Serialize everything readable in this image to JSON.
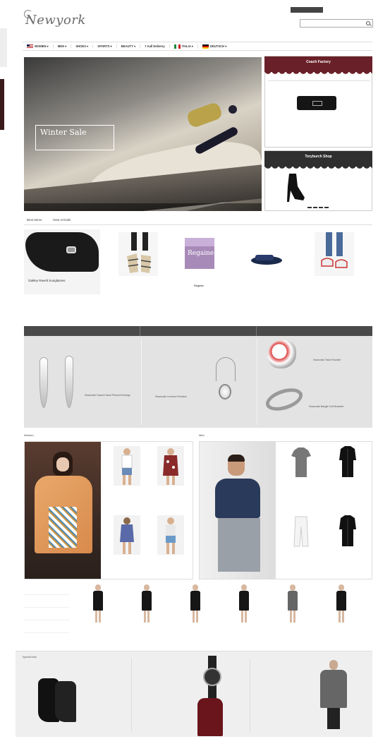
{
  "header": {
    "logo": "Newyork",
    "top_banner": "",
    "util_links": [
      "",
      "",
      "",
      ""
    ],
    "quick_links": [
      "",
      "",
      "",
      "",
      ""
    ],
    "search_placeholder": ""
  },
  "nav": {
    "items": [
      "WOMEN ▾",
      "MEN ▾",
      "SHOES ▾",
      "SPORTS ▾",
      "BEAUTY ▾",
      "7 Aall Delivery",
      "ITALIA ▾",
      "DEUTSCH ▾"
    ]
  },
  "hero": {
    "caption_title": "Winter Sale",
    "caption_sub": "",
    "slide_labels": [
      "",
      "",
      "",
      "",
      ""
    ]
  },
  "coach": {
    "banner": "Coach Factory",
    "tabs": [
      "",
      "",
      "",
      ""
    ],
    "product_name": "",
    "product_desc": "",
    "price": ""
  },
  "tory": {
    "banner": "Toryburch Shop",
    "product_name": "",
    "product_desc": "",
    "price": ""
  },
  "best": {
    "tabs": [
      "Best Items",
      "New Arrivals"
    ],
    "feature_caption": "Oakley Ravelt Sunglasses",
    "items": [
      {
        "name": "",
        "desc": "",
        "price": ""
      },
      {
        "name": "Regaine",
        "desc": "",
        "price": ""
      },
      {
        "name": "",
        "desc": "",
        "price": ""
      },
      {
        "name": "",
        "desc": "",
        "price": ""
      }
    ]
  },
  "jewelry": {
    "heads": [
      "",
      "",
      ""
    ],
    "items": [
      {
        "name": "Swarovski Casuini Sand Pierced Earrings"
      },
      {
        "name": "Swarovski Lemmon Pendant"
      },
      {
        "name": "Swarovski Tisdol Rooster"
      },
      {
        "name": "Swarovski Bangle Cuff Bracelet"
      }
    ]
  },
  "women": {
    "label": "Women",
    "items": [
      {
        "name": "",
        "desc": "",
        "price": ""
      },
      {
        "name": "",
        "desc": "",
        "price": ""
      },
      {
        "name": "",
        "desc": "",
        "price": ""
      },
      {
        "name": "",
        "desc": "",
        "price": ""
      }
    ]
  },
  "men": {
    "label": "Men",
    "items": [
      {
        "name": "",
        "desc": "",
        "price": ""
      },
      {
        "name": "",
        "desc": "",
        "price": ""
      },
      {
        "name": "",
        "desc": "",
        "price": ""
      },
      {
        "name": "",
        "desc": "",
        "price": ""
      }
    ]
  },
  "categories": [
    "",
    "",
    "",
    "",
    ""
  ],
  "dresses": [
    {
      "name": "",
      "desc": "",
      "price": ""
    },
    {
      "name": "",
      "desc": "",
      "price": ""
    },
    {
      "name": "",
      "desc": "",
      "price": ""
    },
    {
      "name": "",
      "desc": "",
      "price": ""
    },
    {
      "name": "",
      "desc": "",
      "price": ""
    },
    {
      "name": "",
      "desc": "",
      "price": ""
    }
  ],
  "special": {
    "label": "Special Deal",
    "boot_name": "",
    "boot_desc": "",
    "watch_name": "",
    "watch_desc": "",
    "burberry_name": "",
    "burberry_desc": "",
    "coat_name": "",
    "coat_desc": ""
  },
  "colors": {
    "coach_awning": "#6a2028",
    "tory_awning": "#2f2f2f",
    "jewel_header": "#4a4a4a"
  }
}
